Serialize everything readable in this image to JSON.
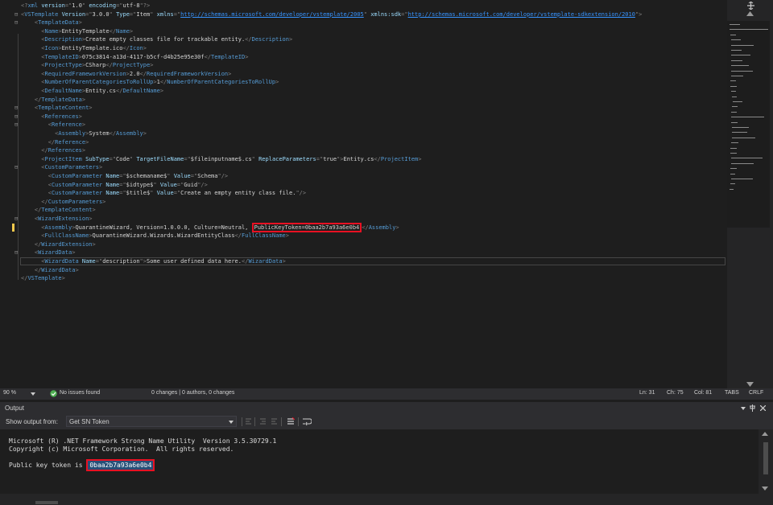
{
  "editor": {
    "lines": [
      [
        [
          "b",
          "<?"
        ],
        [
          "t",
          "xml"
        ],
        [
          "x",
          " "
        ],
        [
          "a",
          "version"
        ],
        [
          "b",
          "=\""
        ],
        [
          "v",
          "1.0"
        ],
        [
          "b",
          "\""
        ],
        [
          "x",
          " "
        ],
        [
          "a",
          "encoding"
        ],
        [
          "b",
          "=\""
        ],
        [
          "v",
          "utf-8"
        ],
        [
          "b",
          "\"?>"
        ]
      ],
      [
        [
          "b",
          "<"
        ],
        [
          "t",
          "VSTemplate"
        ],
        [
          "x",
          " "
        ],
        [
          "a",
          "Version"
        ],
        [
          "b",
          "=\""
        ],
        [
          "v",
          "3.0.0"
        ],
        [
          "b",
          "\""
        ],
        [
          "x",
          " "
        ],
        [
          "a",
          "Type"
        ],
        [
          "b",
          "=\""
        ],
        [
          "v",
          "Item"
        ],
        [
          "b",
          "\""
        ],
        [
          "x",
          " "
        ],
        [
          "a",
          "xmlns"
        ],
        [
          "b",
          "=\""
        ],
        [
          "u",
          "http://schemas.microsoft.com/developer/vstemplate/2005"
        ],
        [
          "b",
          "\""
        ],
        [
          "x",
          " "
        ],
        [
          "a",
          "xmlns:sdk"
        ],
        [
          "b",
          "=\""
        ],
        [
          "u",
          "http://schemas.microsoft.com/developer/vstemplate-sdkextension/2010"
        ],
        [
          "b",
          "\">"
        ]
      ],
      [
        [
          "x",
          "    "
        ],
        [
          "b",
          "<"
        ],
        [
          "t",
          "TemplateData"
        ],
        [
          "b",
          ">"
        ]
      ],
      [
        [
          "x",
          "      "
        ],
        [
          "b",
          "<"
        ],
        [
          "t",
          "Name"
        ],
        [
          "b",
          ">"
        ],
        [
          "x",
          "EntityTemplate"
        ],
        [
          "b",
          "</"
        ],
        [
          "t",
          "Name"
        ],
        [
          "b",
          ">"
        ]
      ],
      [
        [
          "x",
          "      "
        ],
        [
          "b",
          "<"
        ],
        [
          "t",
          "Description"
        ],
        [
          "b",
          ">"
        ],
        [
          "x",
          "Create empty classes file for trackable entity."
        ],
        [
          "b",
          "</"
        ],
        [
          "t",
          "Description"
        ],
        [
          "b",
          ">"
        ]
      ],
      [
        [
          "x",
          "      "
        ],
        [
          "b",
          "<"
        ],
        [
          "t",
          "Icon"
        ],
        [
          "b",
          ">"
        ],
        [
          "x",
          "EntityTemplate.ico"
        ],
        [
          "b",
          "</"
        ],
        [
          "t",
          "Icon"
        ],
        [
          "b",
          ">"
        ]
      ],
      [
        [
          "x",
          "      "
        ],
        [
          "b",
          "<"
        ],
        [
          "t",
          "TemplateID"
        ],
        [
          "b",
          ">"
        ],
        [
          "x",
          "075c3814-a13d-4117-b5cf-d4b25e95e30f"
        ],
        [
          "b",
          "</"
        ],
        [
          "t",
          "TemplateID"
        ],
        [
          "b",
          ">"
        ]
      ],
      [
        [
          "x",
          "      "
        ],
        [
          "b",
          "<"
        ],
        [
          "t",
          "ProjectType"
        ],
        [
          "b",
          ">"
        ],
        [
          "x",
          "CSharp"
        ],
        [
          "b",
          "</"
        ],
        [
          "t",
          "ProjectType"
        ],
        [
          "b",
          ">"
        ]
      ],
      [
        [
          "x",
          "      "
        ],
        [
          "b",
          "<"
        ],
        [
          "t",
          "RequiredFrameworkVersion"
        ],
        [
          "b",
          ">"
        ],
        [
          "x",
          "2.0"
        ],
        [
          "b",
          "</"
        ],
        [
          "t",
          "RequiredFrameworkVersion"
        ],
        [
          "b",
          ">"
        ]
      ],
      [
        [
          "x",
          "      "
        ],
        [
          "b",
          "<"
        ],
        [
          "t",
          "NumberOfParentCategoriesToRollUp"
        ],
        [
          "b",
          ">"
        ],
        [
          "x",
          "1"
        ],
        [
          "b",
          "</"
        ],
        [
          "t",
          "NumberOfParentCategoriesToRollUp"
        ],
        [
          "b",
          ">"
        ]
      ],
      [
        [
          "x",
          "      "
        ],
        [
          "b",
          "<"
        ],
        [
          "t",
          "DefaultName"
        ],
        [
          "b",
          ">"
        ],
        [
          "x",
          "Entity.cs"
        ],
        [
          "b",
          "</"
        ],
        [
          "t",
          "DefaultName"
        ],
        [
          "b",
          ">"
        ]
      ],
      [
        [
          "x",
          "    "
        ],
        [
          "b",
          "</"
        ],
        [
          "t",
          "TemplateData"
        ],
        [
          "b",
          ">"
        ]
      ],
      [
        [
          "x",
          "    "
        ],
        [
          "b",
          "<"
        ],
        [
          "t",
          "TemplateContent"
        ],
        [
          "b",
          ">"
        ]
      ],
      [
        [
          "x",
          "      "
        ],
        [
          "b",
          "<"
        ],
        [
          "t",
          "References"
        ],
        [
          "b",
          ">"
        ]
      ],
      [
        [
          "x",
          "        "
        ],
        [
          "b",
          "<"
        ],
        [
          "t",
          "Reference"
        ],
        [
          "b",
          ">"
        ]
      ],
      [
        [
          "x",
          "          "
        ],
        [
          "b",
          "<"
        ],
        [
          "t",
          "Assembly"
        ],
        [
          "b",
          ">"
        ],
        [
          "x",
          "System"
        ],
        [
          "b",
          "</"
        ],
        [
          "t",
          "Assembly"
        ],
        [
          "b",
          ">"
        ]
      ],
      [
        [
          "x",
          "        "
        ],
        [
          "b",
          "</"
        ],
        [
          "t",
          "Reference"
        ],
        [
          "b",
          ">"
        ]
      ],
      [
        [
          "x",
          "      "
        ],
        [
          "b",
          "</"
        ],
        [
          "t",
          "References"
        ],
        [
          "b",
          ">"
        ]
      ],
      [
        [
          "x",
          "      "
        ],
        [
          "b",
          "<"
        ],
        [
          "t",
          "ProjectItem"
        ],
        [
          "x",
          " "
        ],
        [
          "a",
          "SubType"
        ],
        [
          "b",
          "=\""
        ],
        [
          "v",
          "Code"
        ],
        [
          "b",
          "\""
        ],
        [
          "x",
          " "
        ],
        [
          "a",
          "TargetFileName"
        ],
        [
          "b",
          "=\""
        ],
        [
          "v",
          "$fileinputname$.cs"
        ],
        [
          "b",
          "\""
        ],
        [
          "x",
          " "
        ],
        [
          "a",
          "ReplaceParameters"
        ],
        [
          "b",
          "=\""
        ],
        [
          "v",
          "true"
        ],
        [
          "b",
          "\">"
        ],
        [
          "x",
          "Entity.cs"
        ],
        [
          "b",
          "</"
        ],
        [
          "t",
          "ProjectItem"
        ],
        [
          "b",
          ">"
        ]
      ],
      [
        [
          "x",
          "      "
        ],
        [
          "b",
          "<"
        ],
        [
          "t",
          "CustomParameters"
        ],
        [
          "b",
          ">"
        ]
      ],
      [
        [
          "x",
          "        "
        ],
        [
          "b",
          "<"
        ],
        [
          "t",
          "CustomParameter"
        ],
        [
          "x",
          " "
        ],
        [
          "a",
          "Name"
        ],
        [
          "b",
          "=\""
        ],
        [
          "v",
          "$schemaname$"
        ],
        [
          "b",
          "\""
        ],
        [
          "x",
          " "
        ],
        [
          "a",
          "Value"
        ],
        [
          "b",
          "=\""
        ],
        [
          "v",
          "Schema"
        ],
        [
          "b",
          "\"/>"
        ]
      ],
      [
        [
          "x",
          "        "
        ],
        [
          "b",
          "<"
        ],
        [
          "t",
          "CustomParameter"
        ],
        [
          "x",
          " "
        ],
        [
          "a",
          "Name"
        ],
        [
          "b",
          "=\""
        ],
        [
          "v",
          "$idtype$"
        ],
        [
          "b",
          "\""
        ],
        [
          "x",
          " "
        ],
        [
          "a",
          "Value"
        ],
        [
          "b",
          "=\""
        ],
        [
          "v",
          "Guid"
        ],
        [
          "b",
          "\"/>"
        ]
      ],
      [
        [
          "x",
          "        "
        ],
        [
          "b",
          "<"
        ],
        [
          "t",
          "CustomParameter"
        ],
        [
          "x",
          " "
        ],
        [
          "a",
          "Name"
        ],
        [
          "b",
          "=\""
        ],
        [
          "v",
          "$title$"
        ],
        [
          "b",
          "\""
        ],
        [
          "x",
          " "
        ],
        [
          "a",
          "Value"
        ],
        [
          "b",
          "=\""
        ],
        [
          "v",
          "Create an empty entity class file."
        ],
        [
          "b",
          "\"/>"
        ]
      ],
      [
        [
          "x",
          "      "
        ],
        [
          "b",
          "</"
        ],
        [
          "t",
          "CustomParameters"
        ],
        [
          "b",
          ">"
        ]
      ],
      [
        [
          "x",
          "    "
        ],
        [
          "b",
          "</"
        ],
        [
          "t",
          "TemplateContent"
        ],
        [
          "b",
          ">"
        ]
      ],
      [
        [
          "x",
          "    "
        ],
        [
          "b",
          "<"
        ],
        [
          "t",
          "WizardExtension"
        ],
        [
          "b",
          ">"
        ]
      ],
      [
        [
          "x",
          "      "
        ],
        [
          "b",
          "<"
        ],
        [
          "t",
          "Assembly"
        ],
        [
          "b",
          ">"
        ],
        [
          "x",
          "QuarantineWizard, Version=1.0.0.0, Culture=Neutral, "
        ],
        [
          "h",
          "PublicKeyToken=0baa2b7a93a6e0b4"
        ],
        [
          "b",
          "</"
        ],
        [
          "t",
          "Assembly"
        ],
        [
          "b",
          ">"
        ]
      ],
      [
        [
          "x",
          "      "
        ],
        [
          "b",
          "<"
        ],
        [
          "t",
          "FullClassName"
        ],
        [
          "b",
          ">"
        ],
        [
          "x",
          "QuarantineWizard.Wizards.WizardEntityClass"
        ],
        [
          "b",
          "</"
        ],
        [
          "t",
          "FullClassName"
        ],
        [
          "b",
          ">"
        ]
      ],
      [
        [
          "x",
          "    "
        ],
        [
          "b",
          "</"
        ],
        [
          "t",
          "WizardExtension"
        ],
        [
          "b",
          ">"
        ]
      ],
      [
        [
          "x",
          "    "
        ],
        [
          "b",
          "<"
        ],
        [
          "t",
          "WizardData"
        ],
        [
          "b",
          ">"
        ]
      ],
      [
        [
          "x",
          "      "
        ],
        [
          "b",
          "<"
        ],
        [
          "t",
          "WizardData"
        ],
        [
          "x",
          " "
        ],
        [
          "a",
          "Name"
        ],
        [
          "b",
          "=\""
        ],
        [
          "v",
          "description"
        ],
        [
          "b",
          "\">"
        ],
        [
          "x",
          "Some user defined data here."
        ],
        [
          "b",
          "</"
        ],
        [
          "t",
          "WizardData"
        ],
        [
          "b",
          ">"
        ]
      ],
      [
        [
          "x",
          "    "
        ],
        [
          "b",
          "</"
        ],
        [
          "t",
          "WizardData"
        ],
        [
          "b",
          ">"
        ]
      ],
      [
        [
          "b",
          "</"
        ],
        [
          "t",
          "VSTemplate"
        ],
        [
          "b",
          ">"
        ]
      ]
    ],
    "current_line": 31,
    "changed_line": 27
  },
  "status": {
    "zoom": "90 %",
    "issues": "No issues found",
    "changes": "0 changes | 0 authors, 0 changes",
    "ln": "Ln: 31",
    "ch": "Ch: 75",
    "col": "Col: 81",
    "tabs": "TABS",
    "eol": "CRLF"
  },
  "output": {
    "title": "Output",
    "show_from_label": "Show output from:",
    "source": "Get SN Token",
    "lines": [
      "Microsoft (R) .NET Framework Strong Name Utility  Version 3.5.30729.1",
      "Copyright (c) Microsoft Corporation.  All rights reserved."
    ],
    "token_prefix": "Public key token is ",
    "token": "0baa2b7a93a6e0b4"
  },
  "colors": {
    "highlight_border": "#e81123",
    "tag": "#569cd6",
    "attribute": "#9cdcfe",
    "bracket": "#808080",
    "link": "#3794ff"
  }
}
